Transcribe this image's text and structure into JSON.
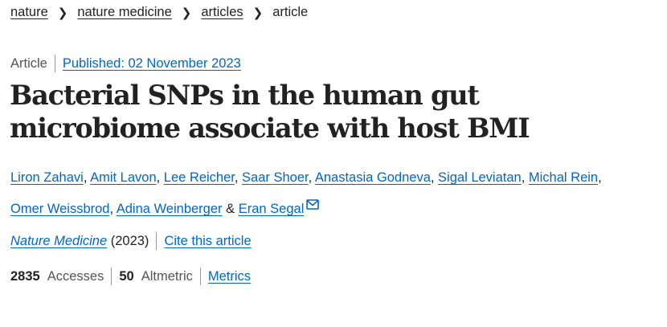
{
  "breadcrumb": {
    "items": [
      "nature",
      "nature medicine",
      "articles"
    ],
    "current": "article"
  },
  "article": {
    "type": "Article",
    "published": "Published: 02 November 2023",
    "title": "Bacterial SNPs in the human gut microbiome associate with host BMI",
    "authors_line1": [
      "Liron Zahavi",
      "Amit Lavon",
      "Lee Reicher",
      "Saar Shoer",
      "Anastasia Godneva",
      "Sigal Leviatan",
      "Michal Rein"
    ],
    "authors_line2": [
      "Omer Weissbrod",
      "Adina Weinberger"
    ],
    "author_separator": ", ",
    "author_conjunction": " & ",
    "last_author": "Eran Segal",
    "journal": "Nature Medicine",
    "year": "(2023)",
    "cite_label": "Cite this article",
    "accesses_count": "2835",
    "accesses_label": "Accesses",
    "altmetric_count": "50",
    "altmetric_label": "Altmetric",
    "metrics_label": "Metrics"
  },
  "icons": {
    "email": "envelope-icon"
  },
  "colors": {
    "link": "#0067c5",
    "text": "#222222",
    "muted": "#555555"
  }
}
